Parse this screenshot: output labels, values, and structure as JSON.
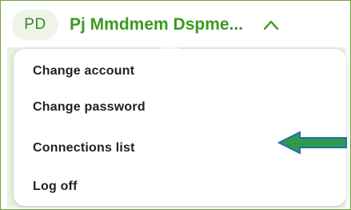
{
  "header": {
    "avatar_initials": "PD",
    "username": "Pj Mmdmem Dspme...",
    "chevron_icon": "chevron-up-icon"
  },
  "menu": {
    "items": [
      {
        "label": "Change account"
      },
      {
        "label": "Change password"
      },
      {
        "label": "Connections list"
      },
      {
        "label": "Log off"
      }
    ]
  },
  "annotation": {
    "arrow_icon": "left-arrow-icon",
    "arrow_color": "#2f9a4a"
  },
  "colors": {
    "brand_green": "#3a9a1f",
    "border_green": "#6fa33a"
  }
}
